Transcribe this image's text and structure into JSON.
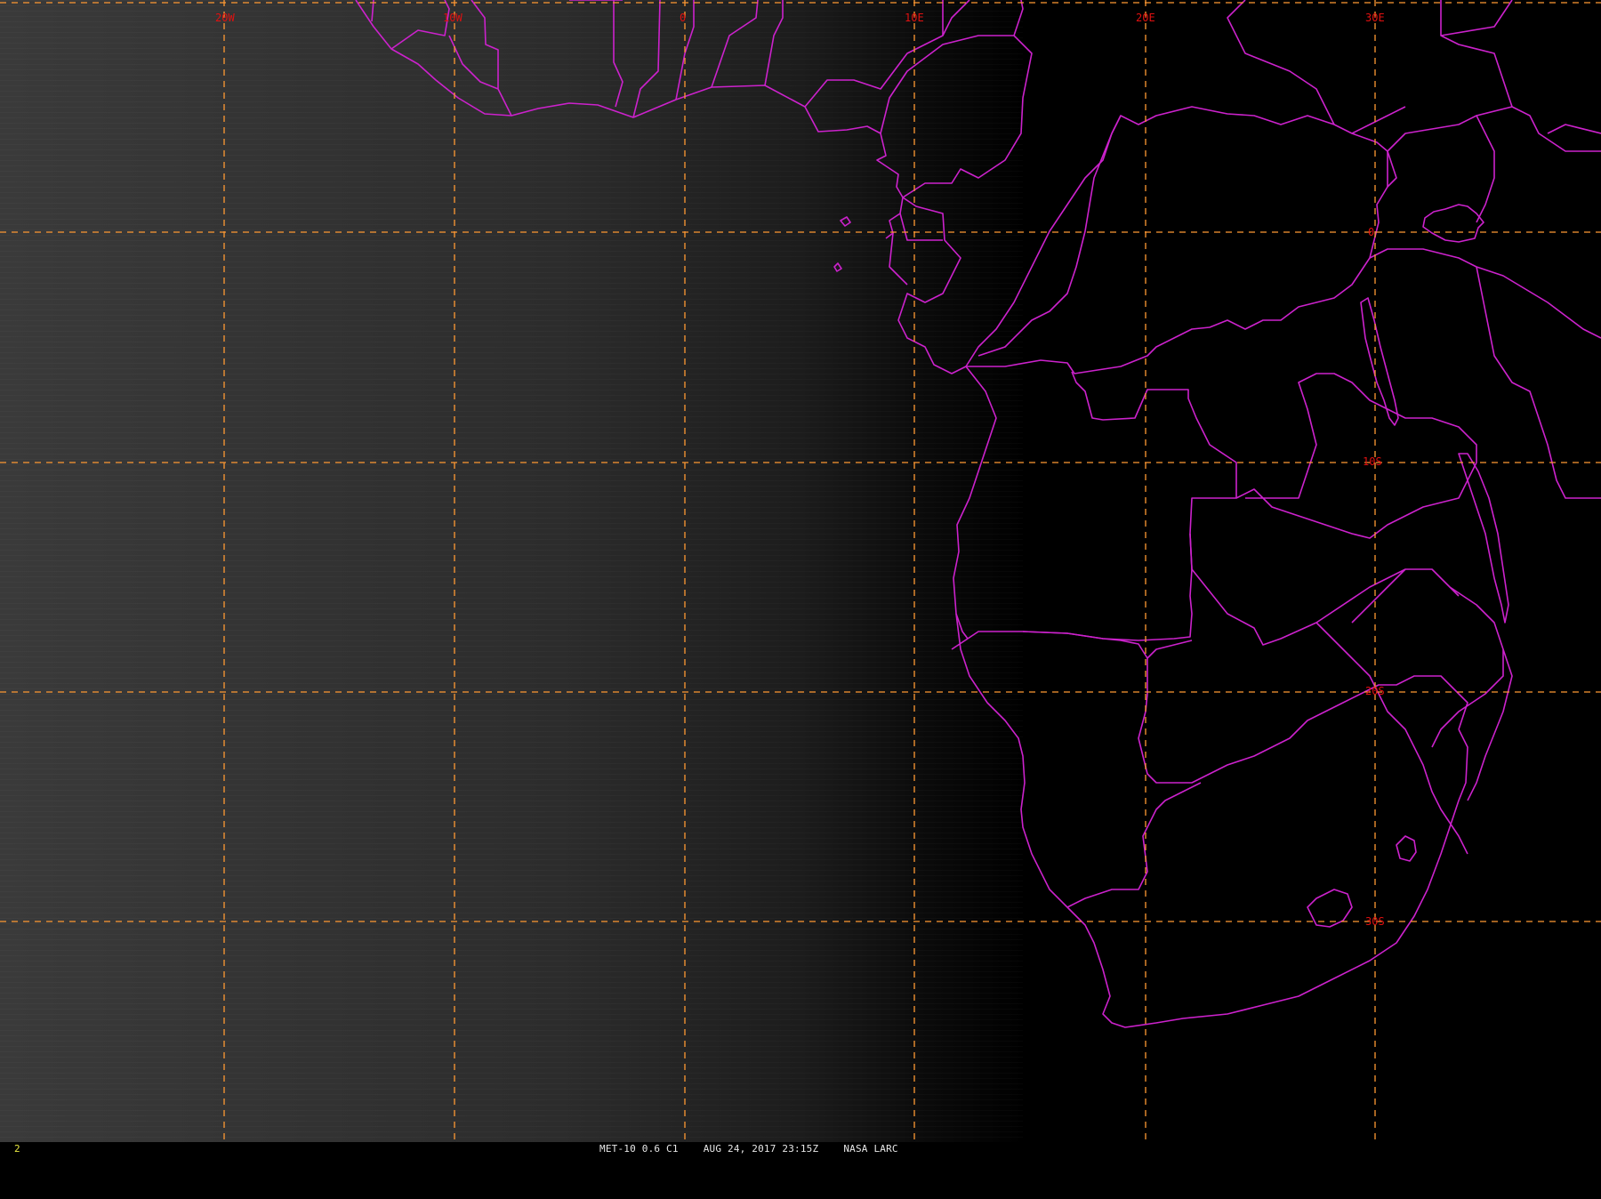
{
  "map": {
    "projection": "satellite view, western and southern Africa with the Gulf of Guinea and South Atlantic",
    "colors": {
      "background_dark": "#000000",
      "ocean_glow": "#3a3a3a",
      "grid_line": "#ff9933",
      "grid_label": "#e01010",
      "boundary": "#cc22cc"
    },
    "grid_style": "dashed",
    "longitude_labels": [
      "20W",
      "10W",
      "0",
      "10E",
      "20E",
      "30E"
    ],
    "latitude_labels": [
      "0",
      "10S",
      "20S",
      "30S"
    ]
  },
  "status_bar": {
    "frame_number": "2",
    "satellite_band": "MET-10 0.6 C1",
    "datetime": "AUG 24, 2017 23:15Z",
    "source": "NASA LARC"
  }
}
